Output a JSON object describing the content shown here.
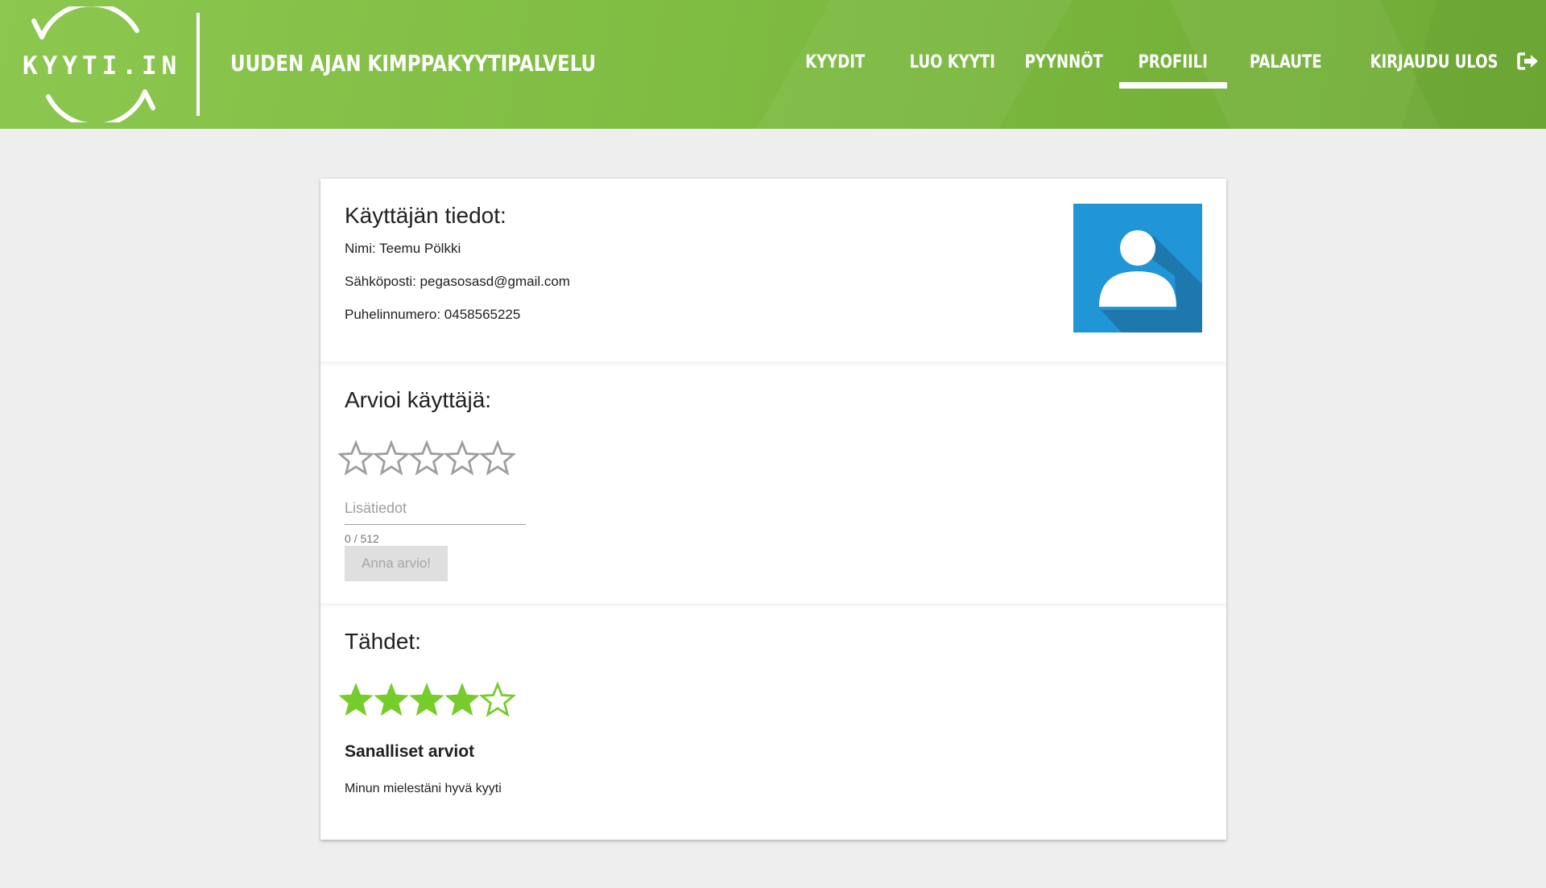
{
  "app": {
    "logo_text": "KYYTI.IN",
    "tagline": "UUDEN AJAN KIMPPAKYYTIPALVELU",
    "brand_color": "#7fbc42",
    "accent_color": "#2196d6",
    "star_color": "#76cc2a"
  },
  "nav": {
    "items": [
      {
        "label": "KYYDIT",
        "active": false
      },
      {
        "label": "LUO KYYTI",
        "active": false
      },
      {
        "label": "PYYNNÖT",
        "active": false
      },
      {
        "label": "PROFIILI",
        "active": true
      },
      {
        "label": "PALAUTE",
        "active": false
      },
      {
        "label": "KIRJAUDU ULOS",
        "active": false,
        "icon": "sign-out-icon"
      }
    ]
  },
  "profile": {
    "heading": "Käyttäjän tiedot:",
    "name_line": "Nimi: Teemu Pölkki",
    "email_line": "Sähköposti: pegasosasd@gmail.com",
    "phone_line": "Puhelinnumero: 0458565225",
    "avatar_icon": "user-avatar-icon"
  },
  "rate": {
    "heading": "Arvioi käyttäjä:",
    "stars_selected": 0,
    "stars_total": 5,
    "field_placeholder": "Lisätiedot",
    "field_value": "",
    "counter": "0 / 512",
    "submit_label": "Anna arvio!"
  },
  "stars": {
    "heading": "Tähdet:",
    "rating": 4,
    "max": 5,
    "reviews_heading": "Sanalliset arviot",
    "reviews": [
      "Minun mielestäni hyvä kyyti"
    ]
  }
}
